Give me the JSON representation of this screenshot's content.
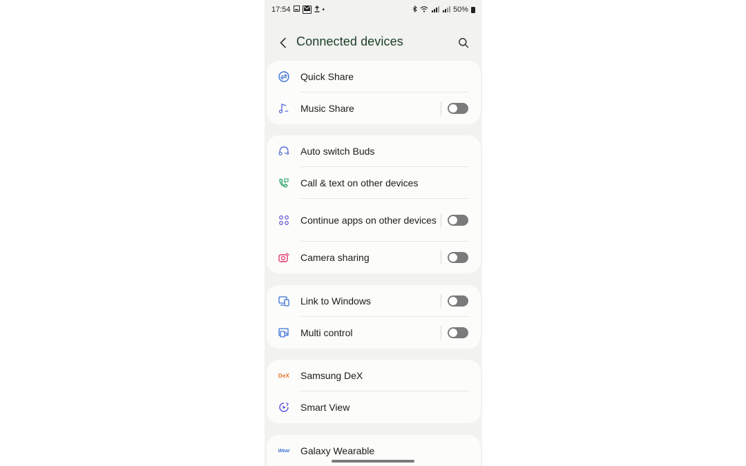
{
  "status_bar": {
    "time": "17:54",
    "battery": "50%",
    "left_icons": [
      "gallery-icon",
      "mail-icon",
      "upload-icon",
      "dot-icon"
    ],
    "right_icons": [
      "bluetooth-icon",
      "wifi-icon",
      "signal-icon",
      "signal-icon"
    ]
  },
  "header": {
    "title": "Connected devices"
  },
  "groups": [
    {
      "items": [
        {
          "label": "Quick Share",
          "icon": "quick-share-icon",
          "toggle": false,
          "color": "#3b6fd8"
        },
        {
          "label": "Music Share",
          "icon": "music-share-icon",
          "toggle": true,
          "on": false,
          "color": "#5a6fd8"
        }
      ]
    },
    {
      "items": [
        {
          "label": "Auto switch Buds",
          "icon": "buds-icon",
          "toggle": false,
          "color": "#5a6fd8"
        },
        {
          "label": "Call & text on other devices",
          "icon": "call-text-icon",
          "toggle": false,
          "color": "#2aa36b"
        },
        {
          "label": "Continue apps on other devices",
          "icon": "continue-apps-icon",
          "toggle": true,
          "on": false,
          "color": "#6a5fd8"
        },
        {
          "label": "Camera sharing",
          "icon": "camera-share-icon",
          "toggle": true,
          "on": false,
          "color": "#e0386f"
        }
      ]
    },
    {
      "items": [
        {
          "label": "Link to Windows",
          "icon": "link-windows-icon",
          "toggle": true,
          "on": false,
          "color": "#3b6fd8"
        },
        {
          "label": "Multi control",
          "icon": "multi-control-icon",
          "toggle": true,
          "on": false,
          "color": "#3b6fd8"
        }
      ]
    },
    {
      "items": [
        {
          "label": "Samsung DeX",
          "icon": "dex-icon",
          "icon_text": "DeX",
          "toggle": false,
          "color": "#e8722a"
        },
        {
          "label": "Smart View",
          "icon": "smart-view-icon",
          "toggle": false,
          "color": "#5a4fd8"
        }
      ]
    },
    {
      "items": [
        {
          "label": "Galaxy Wearable",
          "icon": "wear-icon",
          "icon_text": "Wear",
          "toggle": false,
          "color": "#3b6fd8"
        }
      ]
    }
  ]
}
